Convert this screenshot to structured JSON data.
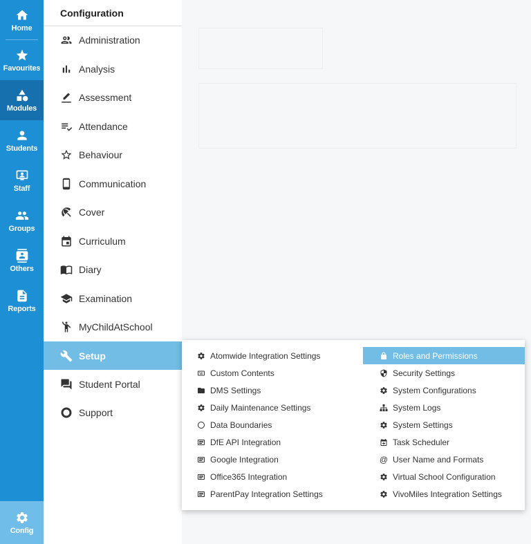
{
  "rail": {
    "items": [
      {
        "label": "Home",
        "icon": "home-icon"
      },
      {
        "label": "Favourites",
        "icon": "star-icon"
      },
      {
        "label": "Modules",
        "icon": "shapes-icon"
      },
      {
        "label": "Students",
        "icon": "person-icon"
      },
      {
        "label": "Staff",
        "icon": "staff-badge-icon"
      },
      {
        "label": "Groups",
        "icon": "people-icon"
      },
      {
        "label": "Others",
        "icon": "contact-icon"
      },
      {
        "label": "Reports",
        "icon": "document-icon"
      }
    ],
    "config": {
      "label": "Config",
      "icon": "gear-icon"
    },
    "active": "Modules"
  },
  "panel": {
    "title": "Configuration",
    "items": [
      {
        "label": "Administration",
        "icon": "people-outline-icon"
      },
      {
        "label": "Analysis",
        "icon": "bar-chart-icon"
      },
      {
        "label": "Assessment",
        "icon": "pencil-icon"
      },
      {
        "label": "Attendance",
        "icon": "checklist-icon"
      },
      {
        "label": "Behaviour",
        "icon": "star-outline-icon"
      },
      {
        "label": "Communication",
        "icon": "phone-icon"
      },
      {
        "label": "Cover",
        "icon": "umbrella-icon"
      },
      {
        "label": "Curriculum",
        "icon": "calendar-icon"
      },
      {
        "label": "Diary",
        "icon": "book-icon"
      },
      {
        "label": "Examination",
        "icon": "mortarboard-icon"
      },
      {
        "label": "MyChildAtSchool",
        "icon": "child-icon"
      },
      {
        "label": "Setup",
        "icon": "wrench-icon"
      },
      {
        "label": "Student Portal",
        "icon": "chat-icon"
      },
      {
        "label": "Support",
        "icon": "ring-icon"
      }
    ],
    "selected": "Setup"
  },
  "flyout": {
    "left": [
      {
        "label": "Atomwide Integration Settings",
        "icon": "gear-icon"
      },
      {
        "label": "Custom Contents",
        "icon": "keyboard-icon"
      },
      {
        "label": "DMS Settings",
        "icon": "folder-icon"
      },
      {
        "label": "Daily Maintenance Settings",
        "icon": "gear-icon"
      },
      {
        "label": "Data Boundaries",
        "icon": "circle-icon"
      },
      {
        "label": "DfE API Integration",
        "icon": "list-icon"
      },
      {
        "label": "Google Integration",
        "icon": "list-icon"
      },
      {
        "label": "Office365 Integration",
        "icon": "list-icon"
      },
      {
        "label": "ParentPay Integration Settings",
        "icon": "list-icon"
      }
    ],
    "right": [
      {
        "label": "Roles and Permissions",
        "icon": "lock-icon"
      },
      {
        "label": "Security Settings",
        "icon": "shield-icon"
      },
      {
        "label": "System Configurations",
        "icon": "gear-icon"
      },
      {
        "label": "System Logs",
        "icon": "sitemap-icon"
      },
      {
        "label": "System Settings",
        "icon": "gear-icon"
      },
      {
        "label": "Task Scheduler",
        "icon": "calendar-plus-icon"
      },
      {
        "label": "User Name and Formats",
        "icon": "at-icon"
      },
      {
        "label": "Virtual School Configuration",
        "icon": "gear-icon"
      },
      {
        "label": "VivoMiles Integration Settings",
        "icon": "gear-icon"
      }
    ],
    "highlighted": "Roles and Permissions"
  }
}
